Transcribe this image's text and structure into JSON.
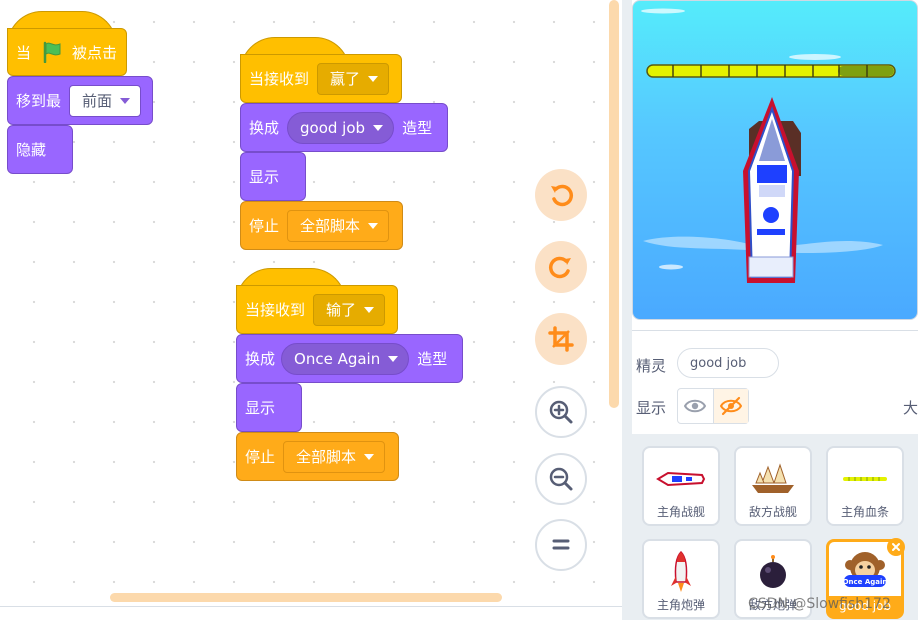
{
  "script1": {
    "hat_prefix": "当",
    "hat_suffix": "被点击",
    "goto_label": "移到最",
    "goto_value": "前面",
    "hide_label": "隐藏"
  },
  "script2": {
    "hat_label": "当接收到",
    "hat_value": "赢了",
    "switch_label": "换成",
    "switch_value": "good job",
    "switch_suffix": "造型",
    "show_label": "显示",
    "stop_label": "停止",
    "stop_value": "全部脚本"
  },
  "script3": {
    "hat_label": "当接收到",
    "hat_value": "输了",
    "switch_label": "换成",
    "switch_value": "Once Again",
    "switch_suffix": "造型",
    "show_label": "显示",
    "stop_label": "停止",
    "stop_value": "全部脚本"
  },
  "zoom_controls": {
    "icons": [
      "undo-icon",
      "redo-icon",
      "crop-icon",
      "zoom-in-icon",
      "zoom-out-icon",
      "zoom-reset-icon"
    ]
  },
  "sprite_info": {
    "sprite_label": "精灵",
    "sprite_name": "good job",
    "show_label": "显示",
    "size_label_partial": "大"
  },
  "sprites": [
    {
      "name": "主角战舰",
      "icon": "player-battleship-icon"
    },
    {
      "name": "敌方战舰",
      "icon": "enemy-battleship-icon"
    },
    {
      "name": "主角血条",
      "icon": "health-bar-icon"
    },
    {
      "name": "主角炮弹",
      "icon": "rocket-icon"
    },
    {
      "name": "敌方炮弹",
      "icon": "bomb-icon"
    },
    {
      "name": "good job",
      "icon": "once-again-monkey-icon",
      "selected": true
    }
  ],
  "sprite_thumb_texts": {
    "once_again_badge": "Once Again"
  },
  "watermark": "CSDN @Slowfish172",
  "colors": {
    "events": "#ffbf00",
    "looks": "#9966ff",
    "control": "#ffab19",
    "selected_sprite": "#ffab19",
    "stage_water": "#4aa9ff"
  }
}
